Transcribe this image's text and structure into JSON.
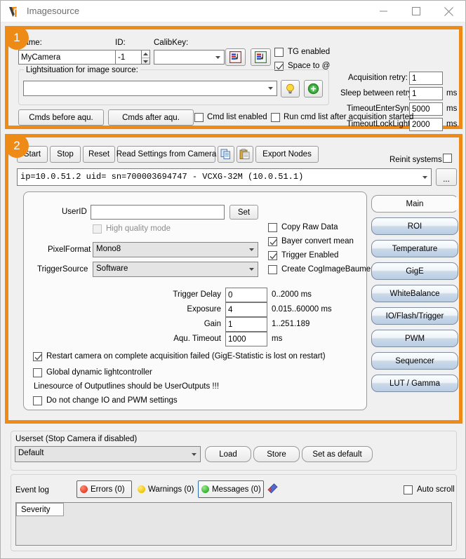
{
  "window": {
    "title": "Imagesource",
    "icon": "vi-logo-icon",
    "controls": {
      "minimize": "minimize-icon",
      "maximize": "maximize-icon",
      "close": "close-icon"
    }
  },
  "section1": {
    "badge": "1",
    "name_label": "Name:",
    "name_value": "MyCamera",
    "id_label": "ID:",
    "id_value": "-1",
    "calibkey_label": "CalibKey:",
    "calibkey_value": "",
    "icon_button_red": "import-calib-red-icon",
    "icon_button_green": "import-calib-green-icon",
    "tg_enabled_label": "TG enabled",
    "tg_enabled_checked": false,
    "space_to_at_label": "Space to @",
    "space_to_at_checked": true,
    "lightsituation_group": "Lightsituation for image source:",
    "lightsituation_value": "",
    "bulb_button": "lightbulb-icon",
    "add_button": "add-green-plus-icon",
    "acquisition_retry_label": "Acquisition retry:",
    "acquisition_retry_value": "1",
    "sleep_between_retry_label": "Sleep between retry:",
    "sleep_between_retry_value": "1",
    "sleep_between_retry_unit": "ms",
    "timeout_entersync_label": "TimeoutEnterSync:",
    "timeout_entersync_value": "5000",
    "timeout_entersync_unit": "ms",
    "timeout_locklight_label": "TimeoutLockLight:",
    "timeout_locklight_value": "2000",
    "timeout_locklight_unit": "ms",
    "cmds_before_label": "Cmds before aqu.",
    "cmds_after_label": "Cmds after aqu.",
    "cmd_list_enabled_label": "Cmd list enabled",
    "cmd_list_enabled_checked": false,
    "run_cmd_list_label": "Run cmd list after acquisition started",
    "run_cmd_list_checked": false
  },
  "section2": {
    "badge": "2",
    "toolbar": {
      "start": "Start",
      "stop": "Stop",
      "reset": "Reset",
      "read_settings": "Read Settings from Camera",
      "copy_icon": "copy-icon",
      "paste_icon": "paste-icon",
      "export_nodes": "Export Nodes",
      "reinit_label": "Reinit systems",
      "reinit_checked": false
    },
    "device": {
      "value": "ip=10.0.51.2 uid= sn=700003694747 - VCXG-32M (10.0.51.1)",
      "browse_label": "..."
    },
    "main_panel": {
      "userid_label": "UserID",
      "userid_value": "",
      "set_label": "Set",
      "high_quality_label": "High quality mode",
      "high_quality_checked": false,
      "high_quality_disabled": true,
      "pixelformat_label": "PixelFormat",
      "pixelformat_value": "Mono8",
      "triggersource_label": "TriggerSource",
      "triggersource_value": "Software",
      "copy_raw_label": "Copy Raw Data",
      "copy_raw_checked": false,
      "bayer_label": "Bayer convert mean",
      "bayer_checked": true,
      "trigger_enabled_label": "Trigger Enabled",
      "trigger_enabled_checked": true,
      "cog_label": "Create CogImageBaumer",
      "cog_checked": false,
      "fields": [
        {
          "label": "Trigger Delay",
          "value": "0",
          "range": "0..2000 ms"
        },
        {
          "label": "Exposure",
          "value": "4",
          "range": "0.015..60000 ms"
        },
        {
          "label": "Gain",
          "value": "1",
          "range": "1..251.189"
        },
        {
          "label": "Aqu. Timeout",
          "value": "1000",
          "range": "ms"
        }
      ],
      "restart_label": "Restart camera on complete acquisition failed (GigE-Statistic is lost on restart)",
      "restart_checked": true,
      "global_light_label": "Global dynamic lightcontroller",
      "global_light_checked": false,
      "linesource_note": "Linesource of Outputlines should be UserOutputs !!!",
      "no_io_pwm_label": "Do not change IO and PWM settings",
      "no_io_pwm_checked": false
    },
    "tabs": [
      {
        "label": "Main",
        "active": true
      },
      {
        "label": "ROI",
        "active": false
      },
      {
        "label": "Temperature",
        "active": false
      },
      {
        "label": "GigE",
        "active": false
      },
      {
        "label": "WhiteBalance",
        "active": false
      },
      {
        "label": "IO/Flash/Trigger",
        "active": false
      },
      {
        "label": "PWM",
        "active": false
      },
      {
        "label": "Sequencer",
        "active": false
      },
      {
        "label": "LUT / Gamma",
        "active": false
      }
    ]
  },
  "userset": {
    "group_label": "Userset (Stop Camera if disabled)",
    "value": "Default",
    "load_label": "Load",
    "store_label": "Store",
    "set_default_label": "Set as default"
  },
  "eventlog": {
    "title": "Event log",
    "errors_label": "Errors (0)",
    "warnings_label": "Warnings (0)",
    "messages_label": "Messages (0)",
    "clear_icon": "eraser-icon",
    "auto_scroll_label": "Auto scroll",
    "auto_scroll_checked": false,
    "column_severity": "Severity"
  },
  "colors": {
    "accent_orange": "#ee8b16",
    "select_blue": "#2b6cb7",
    "error_red": "#e8402a",
    "warning_yellow": "#f2c500",
    "message_green": "#34b233"
  }
}
